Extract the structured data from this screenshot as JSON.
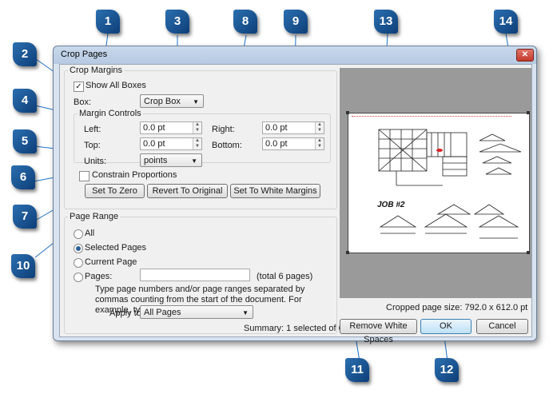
{
  "window": {
    "title": "Crop Pages",
    "close_label": "✕"
  },
  "crop_margins": {
    "group_label": "Crop Margins",
    "show_all_boxes": {
      "label": "Show All Boxes",
      "checked": true
    },
    "box_label": "Box:",
    "box_value": "Crop Box",
    "margin_controls": {
      "label": "Margin Controls",
      "left_label": "Left:",
      "left_value": "0.0 pt",
      "right_label": "Right:",
      "right_value": "0.0 pt",
      "top_label": "Top:",
      "top_value": "0.0 pt",
      "bottom_label": "Bottom:",
      "bottom_value": "0.0 pt",
      "units_label": "Units:",
      "units_value": "points"
    },
    "constrain_label": "Constrain Proportions",
    "set_to_zero": "Set To Zero",
    "revert": "Revert To Original",
    "set_white_margins": "Set To White Margins"
  },
  "page_range": {
    "group_label": "Page Range",
    "all": "All",
    "selected_pages": "Selected Pages",
    "current_page": "Current Page",
    "pages": "Pages:",
    "pages_value": "",
    "total": "(total 6 pages)",
    "help_text": "Type page numbers and/or page ranges separated by commas counting from the start of the document. For example, type 1, 3, 5-12",
    "apply_to_label": "Apply to:",
    "apply_to_value": "All Pages",
    "summary": "Summary: 1 selected of 6 pages"
  },
  "preview": {
    "cropped_size": "Cropped page size: 792.0 x 612.0 pt",
    "drawing_caption": "JOB #2"
  },
  "buttons": {
    "remove_white": "Remove White Spaces",
    "ok": "OK",
    "cancel": "Cancel"
  },
  "callouts": [
    "1",
    "2",
    "3",
    "4",
    "5",
    "6",
    "7",
    "8",
    "9",
    "10",
    "11",
    "12",
    "13",
    "14"
  ],
  "colors": {
    "callout": "#1f5a98",
    "accent": "#3c7fb1"
  }
}
